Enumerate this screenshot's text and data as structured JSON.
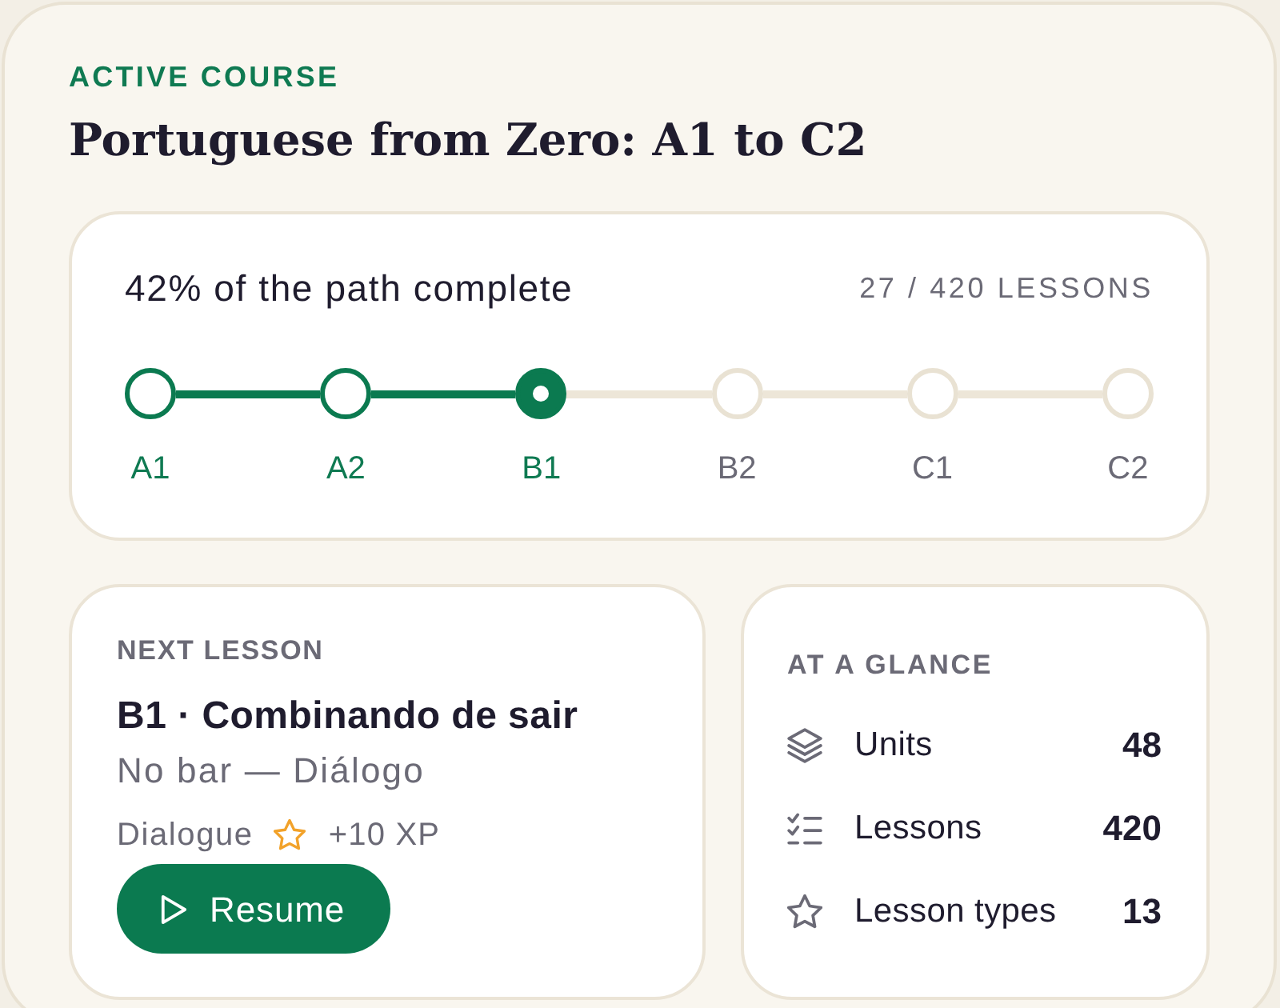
{
  "course": {
    "eyebrow": "ACTIVE COURSE",
    "title": "Portuguese from Zero: A1 to C2"
  },
  "progress": {
    "summary": "42% of the path complete",
    "count": "27 / 420 LESSONS",
    "levels": [
      {
        "label": "A1",
        "completed": true,
        "selected": false
      },
      {
        "label": "A2",
        "completed": true,
        "selected": false
      },
      {
        "label": "B1",
        "completed": false,
        "selected": true
      },
      {
        "label": "B2",
        "completed": false,
        "selected": false
      },
      {
        "label": "C1",
        "completed": false,
        "selected": false
      },
      {
        "label": "C2",
        "completed": false,
        "selected": false
      }
    ]
  },
  "next_lesson": {
    "heading": "NEXT LESSON",
    "title": "B1 · Combinando de sair",
    "subtitle": "No bar — Diálogo",
    "type": "Dialogue",
    "xp": "+10 XP",
    "button": "Resume"
  },
  "glance": {
    "heading": "AT A GLANCE",
    "stats": [
      {
        "kind": "layers",
        "label": "Units",
        "value": "48"
      },
      {
        "kind": "checklist",
        "label": "Lessons",
        "value": "420"
      },
      {
        "kind": "star",
        "label": "Lesson types",
        "value": "13"
      }
    ]
  }
}
